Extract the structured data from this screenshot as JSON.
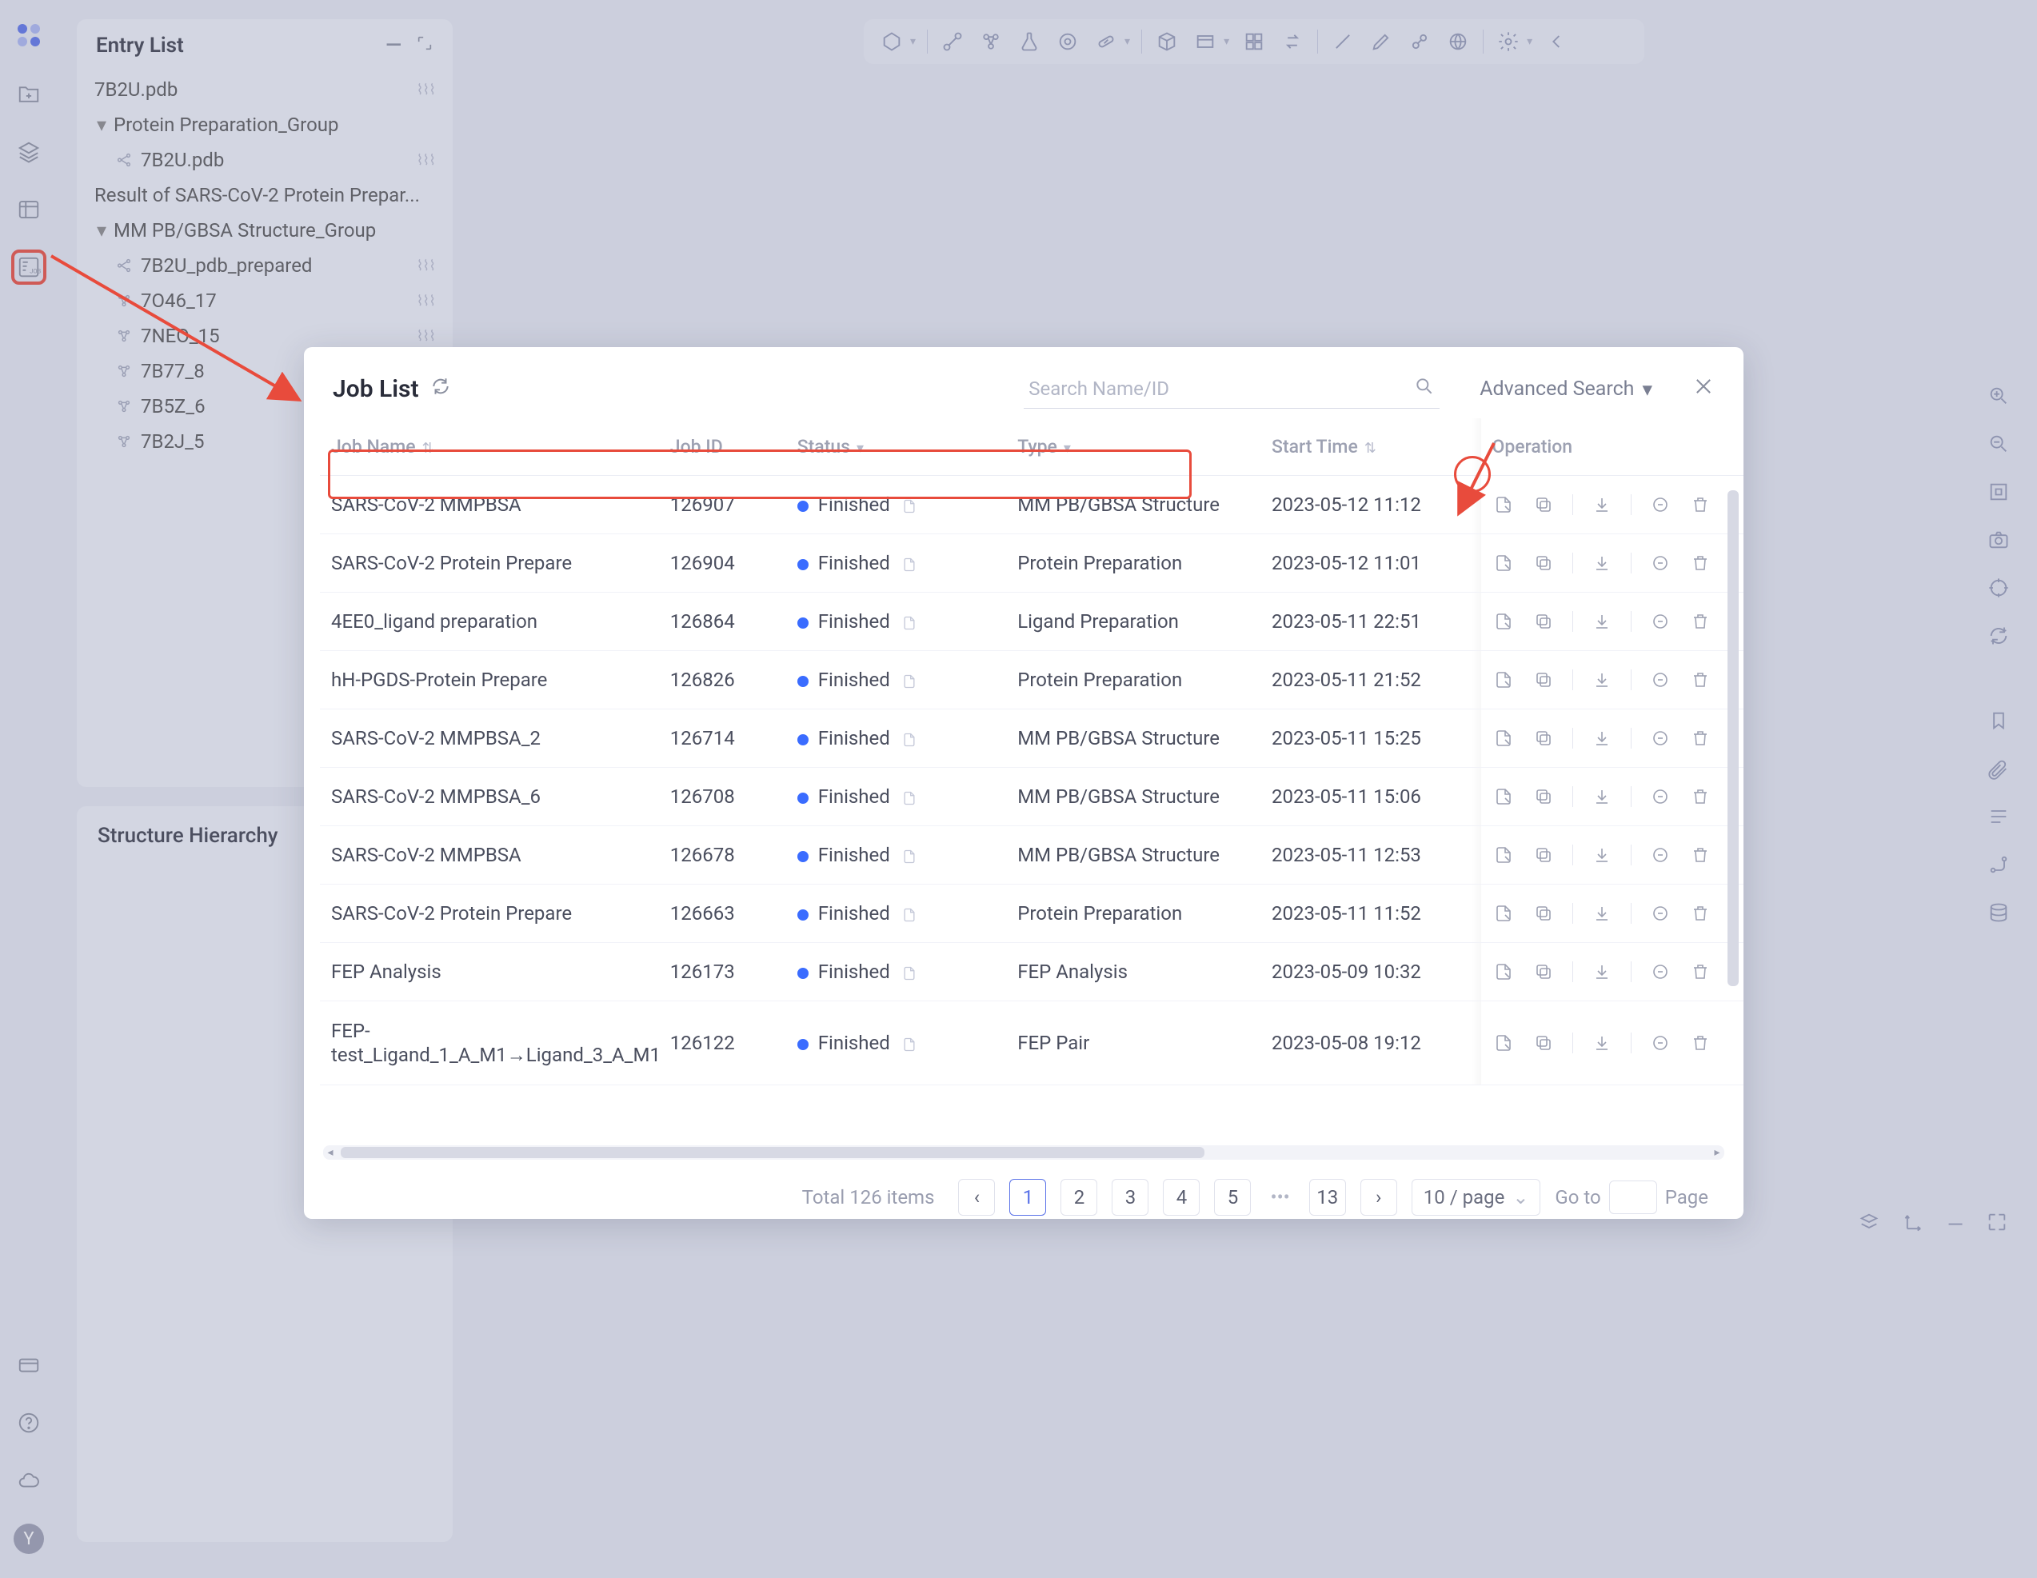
{
  "left_rail": {
    "avatar_initial": "Y"
  },
  "entry_panel": {
    "title": "Entry List",
    "tree": {
      "items": [
        {
          "label": "7B2U.pdb"
        },
        {
          "label": "Protein Preparation_Group"
        },
        {
          "label": "7B2U.pdb"
        },
        {
          "label": "Result of SARS-CoV-2 Protein Prepar..."
        },
        {
          "label": "MM PB/GBSA Structure_Group"
        },
        {
          "label": "7B2U_pdb_prepared"
        },
        {
          "label": "7O46_17"
        },
        {
          "label": "7NEO_15"
        },
        {
          "label": "7B77_8"
        },
        {
          "label": "7B5Z_6"
        },
        {
          "label": "7B2J_5"
        }
      ]
    }
  },
  "hier_panel": {
    "title": "Structure Hierarchy"
  },
  "modal": {
    "title": "Job List",
    "search_placeholder": "Search Name/ID",
    "advanced_label": "Advanced Search",
    "columns": {
      "name": "Job Name",
      "id": "Job ID",
      "status": "Status",
      "type": "Type",
      "start": "Start Time",
      "ops": "Operation"
    },
    "rows": [
      {
        "name": "SARS-CoV-2 MMPBSA",
        "id": "126907",
        "status": "Finished",
        "type": "MM PB/GBSA Structure",
        "start": "2023-05-12 11:12"
      },
      {
        "name": "SARS-CoV-2 Protein Prepare",
        "id": "126904",
        "status": "Finished",
        "type": "Protein Preparation",
        "start": "2023-05-12 11:01"
      },
      {
        "name": "4EE0_ligand preparation",
        "id": "126864",
        "status": "Finished",
        "type": "Ligand Preparation",
        "start": "2023-05-11 22:51"
      },
      {
        "name": "hH-PGDS-Protein Prepare",
        "id": "126826",
        "status": "Finished",
        "type": "Protein Preparation",
        "start": "2023-05-11 21:52"
      },
      {
        "name": "SARS-CoV-2 MMPBSA_2",
        "id": "126714",
        "status": "Finished",
        "type": "MM PB/GBSA Structure",
        "start": "2023-05-11 15:25"
      },
      {
        "name": "SARS-CoV-2 MMPBSA_6",
        "id": "126708",
        "status": "Finished",
        "type": "MM PB/GBSA Structure",
        "start": "2023-05-11 15:06"
      },
      {
        "name": "SARS-CoV-2 MMPBSA",
        "id": "126678",
        "status": "Finished",
        "type": "MM PB/GBSA Structure",
        "start": "2023-05-11 12:53"
      },
      {
        "name": "SARS-CoV-2 Protein Prepare",
        "id": "126663",
        "status": "Finished",
        "type": "Protein Preparation",
        "start": "2023-05-11 11:52"
      },
      {
        "name": "FEP Analysis",
        "id": "126173",
        "status": "Finished",
        "type": "FEP Analysis",
        "start": "2023-05-09 10:32"
      },
      {
        "name": "FEP-test_Ligand_1_A_M1→Ligand_3_A_M1",
        "id": "126122",
        "status": "Finished",
        "type": "FEP Pair",
        "start": "2023-05-08 19:12"
      }
    ],
    "pagination": {
      "total_label": "Total 126 items",
      "pages": [
        "1",
        "2",
        "3",
        "4",
        "5",
        "13"
      ],
      "page_size_label": "10 / page",
      "goto_label": "Go to",
      "page_word": "Page"
    }
  }
}
